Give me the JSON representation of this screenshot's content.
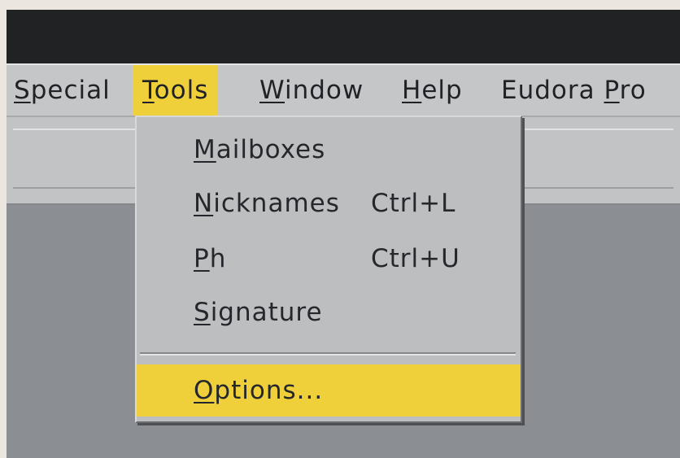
{
  "menubar": {
    "items": [
      {
        "mnemonic": "S",
        "rest": "pecial"
      },
      {
        "mnemonic": "T",
        "rest": "ools"
      },
      {
        "mnemonic": "W",
        "rest": "indow"
      },
      {
        "mnemonic": "H",
        "rest": "elp"
      },
      {
        "prefix": "Eudora ",
        "mnemonic": "P",
        "rest": "ro"
      }
    ],
    "active_index": 1
  },
  "tools_menu": {
    "items": [
      {
        "mnemonic": "M",
        "rest": "ailboxes",
        "shortcut": ""
      },
      {
        "mnemonic": "N",
        "rest": "icknames",
        "shortcut": "Ctrl+L"
      },
      {
        "mnemonic": "P",
        "rest": "h",
        "shortcut": "Ctrl+U"
      },
      {
        "mnemonic": "S",
        "rest": "ignature",
        "shortcut": ""
      },
      {
        "mnemonic": "O",
        "rest": "ptions...",
        "shortcut": ""
      }
    ],
    "highlighted_index": 4
  },
  "colors": {
    "highlight": "#efcf3a",
    "menu_bg": "#c4c6c7",
    "title_bar": "#202224",
    "workspace": "#8b8e93"
  }
}
